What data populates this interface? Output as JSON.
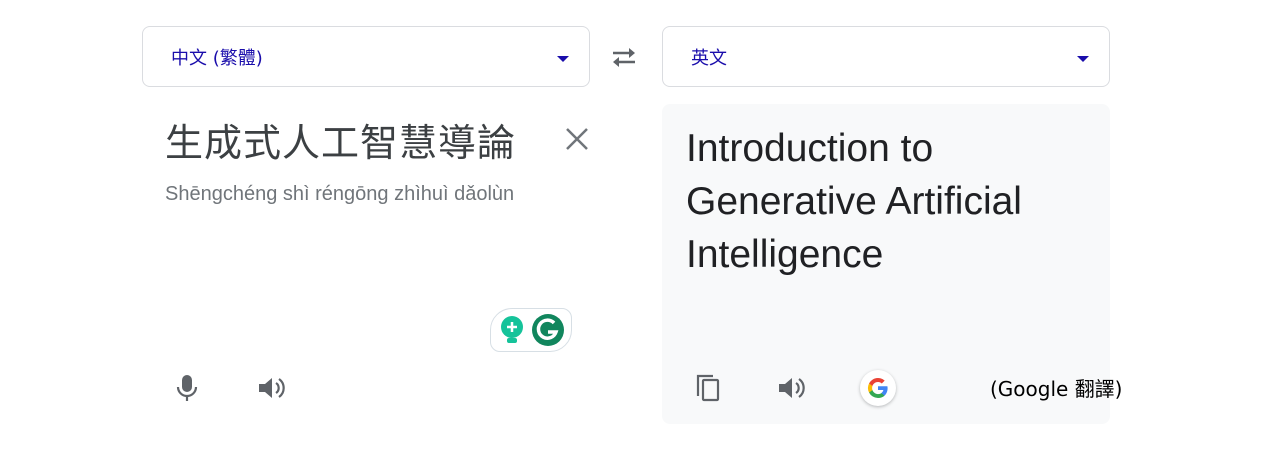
{
  "source_language": {
    "label": "中文 (繁體)"
  },
  "target_language": {
    "label": "英文"
  },
  "source": {
    "text": "生成式人工智慧導論",
    "romanization": "Shēngchéng shì réngōng zhìhuì dǎolùn"
  },
  "target": {
    "text": "Introduction to Generative Artificial Intelligence"
  },
  "attribution": "(Google 翻譯)",
  "colors": {
    "accent": "#1a0dab",
    "icon_gray": "#5f6368",
    "panel_bg": "#f8f9fa",
    "grammarly_green": "#15c39a",
    "grammarly_dark": "#11865d"
  },
  "icons": {
    "swap": "swap-arrows-icon",
    "clear": "close-icon",
    "mic": "microphone-icon",
    "speaker": "speaker-icon",
    "copy": "copy-icon",
    "google": "google-g-icon",
    "grammarly_bulb": "lightbulb-icon",
    "grammarly": "grammarly-icon"
  }
}
